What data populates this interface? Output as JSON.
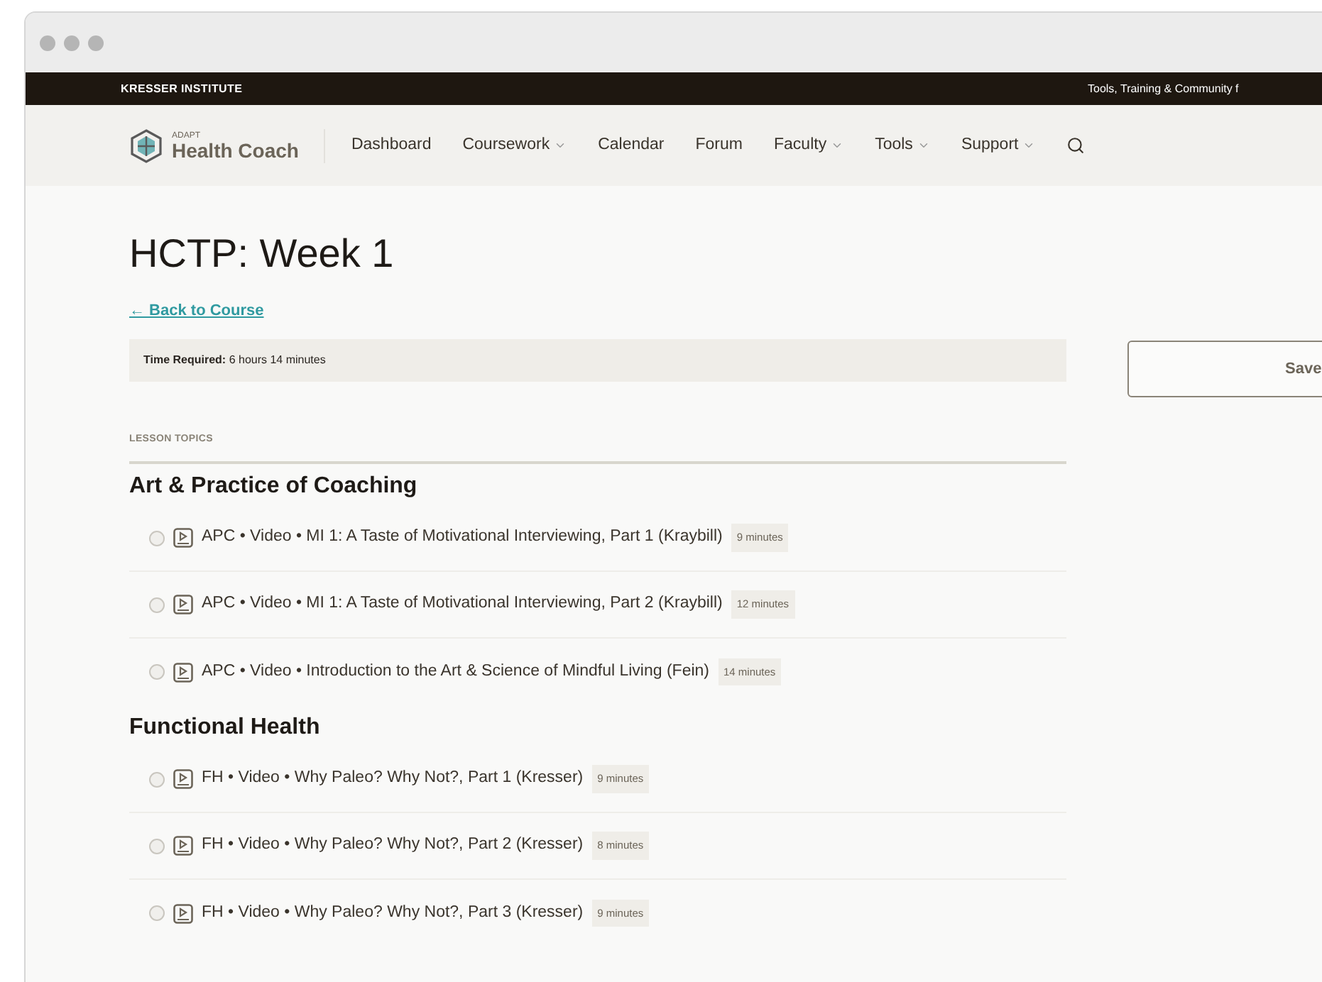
{
  "top_bar": {
    "brand": "KRESSER INSTITUTE",
    "tagline": "Tools, Training & Community f"
  },
  "logo": {
    "small": "ADAPT",
    "name": "Health Coach"
  },
  "nav": [
    {
      "label": "Dashboard",
      "has_menu": false
    },
    {
      "label": "Coursework",
      "has_menu": true
    },
    {
      "label": "Calendar",
      "has_menu": false
    },
    {
      "label": "Forum",
      "has_menu": false
    },
    {
      "label": "Faculty",
      "has_menu": true
    },
    {
      "label": "Tools",
      "has_menu": true
    },
    {
      "label": "Support",
      "has_menu": true
    }
  ],
  "page": {
    "title": "HCTP: Week 1",
    "back_link": "← Back to Course",
    "time_required": "**Time Required:** 6 hours 14 minutes",
    "section_label": "LESSON TOPICS",
    "save_button": "Save"
  },
  "sections": [
    {
      "title": "Art & Practice of Coaching",
      "lessons": [
        {
          "title": "APC • Video • MI 1: A Taste of Motivational Interviewing, Part 1 (Kraybill)",
          "duration": "9 minutes",
          "completed": false
        },
        {
          "title": "APC • Video • MI 1: A Taste of Motivational Interviewing, Part 2 (Kraybill)",
          "duration": "12 minutes",
          "completed": false
        },
        {
          "title": "APC • Video • Introduction to the Art & Science of Mindful Living (Fein)",
          "duration": "14 minutes",
          "completed": false
        }
      ]
    },
    {
      "title": "Functional Health",
      "lessons": [
        {
          "title": "FH • Video • Why Paleo? Why Not?, Part 1 (Kresser)",
          "duration": "9 minutes",
          "completed": false
        },
        {
          "title": "FH • Video • Why Paleo? Why Not?, Part 2 (Kresser)",
          "duration": "8 minutes",
          "completed": false
        },
        {
          "title": "FH • Video • Why Paleo? Why Not?, Part 3 (Kresser)",
          "duration": "9 minutes",
          "completed": false
        }
      ]
    }
  ]
}
